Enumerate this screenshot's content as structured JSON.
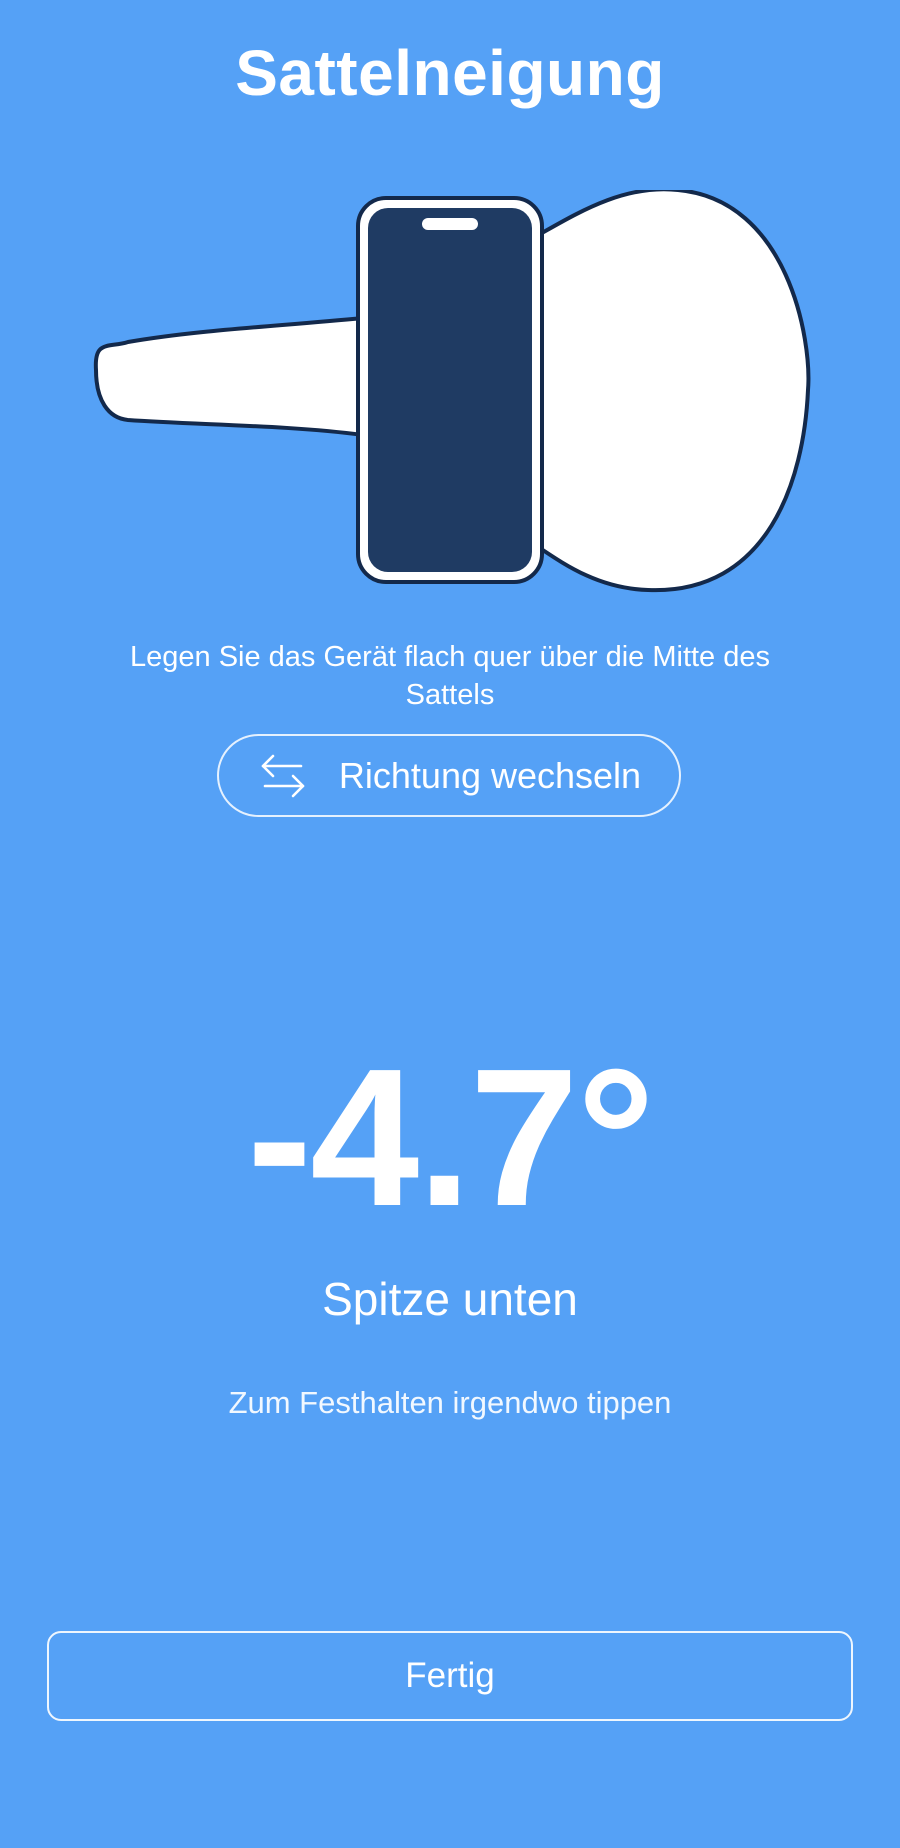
{
  "header": {
    "title": "Sattelneigung"
  },
  "illustration": {
    "saddle_icon": "saddle-illustration",
    "phone_icon": "phone-illustration",
    "colors": {
      "saddle_fill": "#ffffff",
      "outline": "#13294b",
      "phone_screen": "#1f3b63"
    }
  },
  "instruction": {
    "text": "Legen Sie das Gerät flach quer über die Mitte des Sattels"
  },
  "swap_button": {
    "icon": "swap-arrows-icon",
    "label": "Richtung wechseln"
  },
  "reading": {
    "angle": "-4.7°",
    "direction": "Spitze unten",
    "hint": "Zum Festhalten irgendwo tippen"
  },
  "footer": {
    "done_label": "Fertig"
  },
  "theme": {
    "background": "#55a1f6",
    "text": "#ffffff"
  }
}
